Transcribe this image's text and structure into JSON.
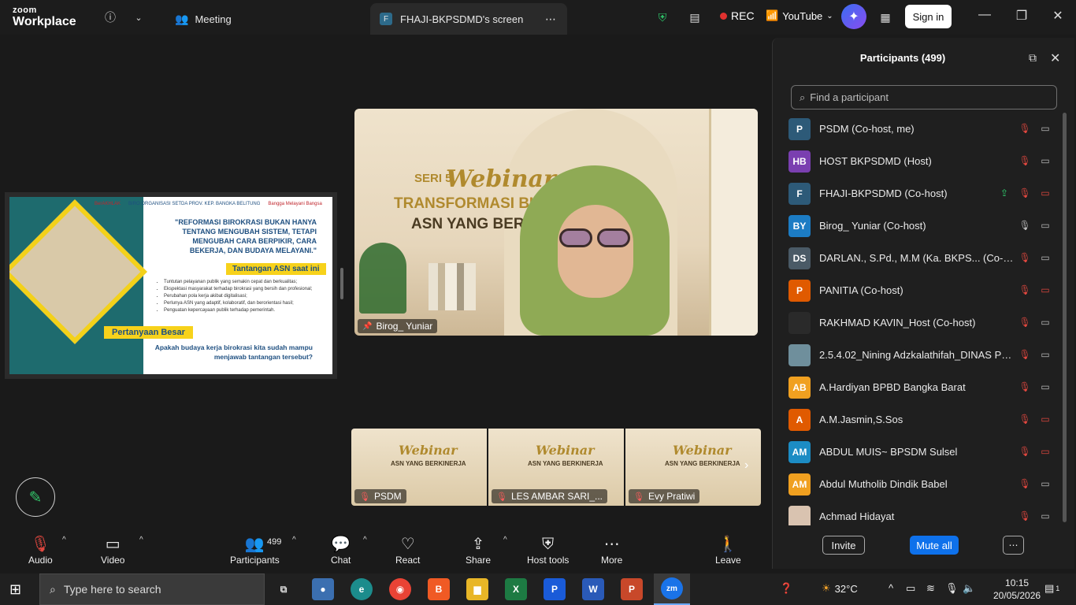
{
  "app": {
    "brand_top": "zoom",
    "brand_bottom": "Workplace"
  },
  "tabs": [
    {
      "label": "Meeting"
    },
    {
      "badge": "F",
      "label": "FHAJI-BKPSDMD's screen"
    }
  ],
  "titlebar": {
    "rec_label": "REC",
    "youtube_label": "YouTube",
    "signin_label": "Sign in"
  },
  "shared_slide": {
    "logos": [
      "BerAKHLAK",
      "BIRO ORGANISASI SETDA PROV. KEP. BANGKA BELITUNG",
      "Bangga Melayani Bangsa"
    ],
    "quote": "\"REFORMASI BIROKRASI BUKAN HANYA TENTANG MENGUBAH SISTEM, TETAPI MENGUBAH CARA BERPIKIR, CARA BEKERJA, DAN BUDAYA MELAYANI.\"",
    "heading": "Tantangan ASN saat ini",
    "bullets": [
      "Tuntutan pelayanan publik yang semakin cepat dan berkualitas;",
      "Ekspektasi masyarakat terhadap birokrasi yang bersih dan profesional;",
      "Perubahan pola kerja akibat digitalisasi;",
      "Perlunya ASN yang adaptif, kolaboratif, dan berorientasi hasil;",
      "Penguatan kepercayaan publik terhadap pemerintah."
    ],
    "question_head": "Pertanyaan Besar",
    "question": "Apakah budaya kerja birokrasi kita sudah mampu menjawab tantangan tersebut?"
  },
  "speaker": {
    "name": "Birog_ Yuniar",
    "seri": "SERI 5",
    "webinar": "Webinar",
    "line1": "TRANSFORMASI BUDAY",
    "line2": "ASN YANG BERKIN"
  },
  "thumbnails": [
    {
      "name": "PSDM",
      "webinar": "Webinar",
      "line": "ASN YANG BERKINERJA"
    },
    {
      "name": "LES AMBAR SARI_...",
      "webinar": "Webinar",
      "line": "ASN YANG BERKINERJA"
    },
    {
      "name": "Evy Pratiwi",
      "webinar": "Webinar",
      "line": "ASN YANG BERKINERJA"
    }
  ],
  "panel": {
    "title": "Participants (499)",
    "search_placeholder": "Find a participant",
    "invite_label": "Invite",
    "mute_all_label": "Mute all",
    "participants": [
      {
        "initials": "P",
        "color": "#2d5a78",
        "name": "PSDM (Co-host, me)",
        "icons": [
          "mute",
          "cam"
        ]
      },
      {
        "initials": "HB",
        "color": "#7a3fb0",
        "name": "HOST BKPSDMD (Host)",
        "icons": [
          "rec",
          "mute",
          "cam"
        ]
      },
      {
        "initials": "F",
        "color": "#2d5a78",
        "name": "FHAJI-BKPSDMD (Co-host)",
        "icons": [
          "share",
          "mute",
          "camoff"
        ]
      },
      {
        "initials": "BY",
        "color": "#1c7cc4",
        "name": "Birog_ Yuniar (Co-host)",
        "icons": [
          "mic",
          "cam"
        ]
      },
      {
        "initials": "DS",
        "color": "#4a5a66",
        "name": "DARLAN., S.Pd., M.M (Ka. BKPS... (Co-host)",
        "icons": [
          "mute",
          "cam"
        ]
      },
      {
        "initials": "P",
        "color": "#e05a00",
        "name": "PANITIA (Co-host)",
        "icons": [
          "mute",
          "camoff"
        ]
      },
      {
        "initials": "",
        "color": "#2a2a2a",
        "name": "RAKHMAD KAVIN_Host (Co-host)",
        "icons": [
          "mute",
          "cam"
        ]
      },
      {
        "initials": "",
        "color": "#6f8f9c",
        "name": "2.5.4.02_Nining Adzkalathifah_DINAS PER...",
        "icons": [
          "mute",
          "cam"
        ]
      },
      {
        "initials": "AB",
        "color": "#f0a020",
        "name": "A.Hardiyan BPBD Bangka Barat",
        "icons": [
          "mute",
          "cam"
        ]
      },
      {
        "initials": "A",
        "color": "#e05a00",
        "name": "A.M.Jasmin,S.Sos",
        "icons": [
          "mute",
          "camoff"
        ]
      },
      {
        "initials": "AM",
        "color": "#1c8cc4",
        "name": "ABDUL MUIS~ BPSDM Sulsel",
        "icons": [
          "mute",
          "camoff"
        ]
      },
      {
        "initials": "AM",
        "color": "#f0a020",
        "name": "Abdul Mutholib Dindik Babel",
        "icons": [
          "mute",
          "cam"
        ]
      },
      {
        "initials": "",
        "color": "#d9c3b0",
        "name": "Achmad Hidayat",
        "icons": [
          "mute",
          "cam"
        ]
      }
    ]
  },
  "toolbar": {
    "audio": "Audio",
    "video": "Video",
    "participants": "Participants",
    "participants_count": "499",
    "chat": "Chat",
    "react": "React",
    "share": "Share",
    "host_tools": "Host tools",
    "more": "More",
    "leave": "Leave"
  },
  "taskbar": {
    "search_placeholder": "Type here to search",
    "temperature": "32°C",
    "time": "10:15",
    "date": "20/05/2026",
    "notif_count": "1"
  }
}
